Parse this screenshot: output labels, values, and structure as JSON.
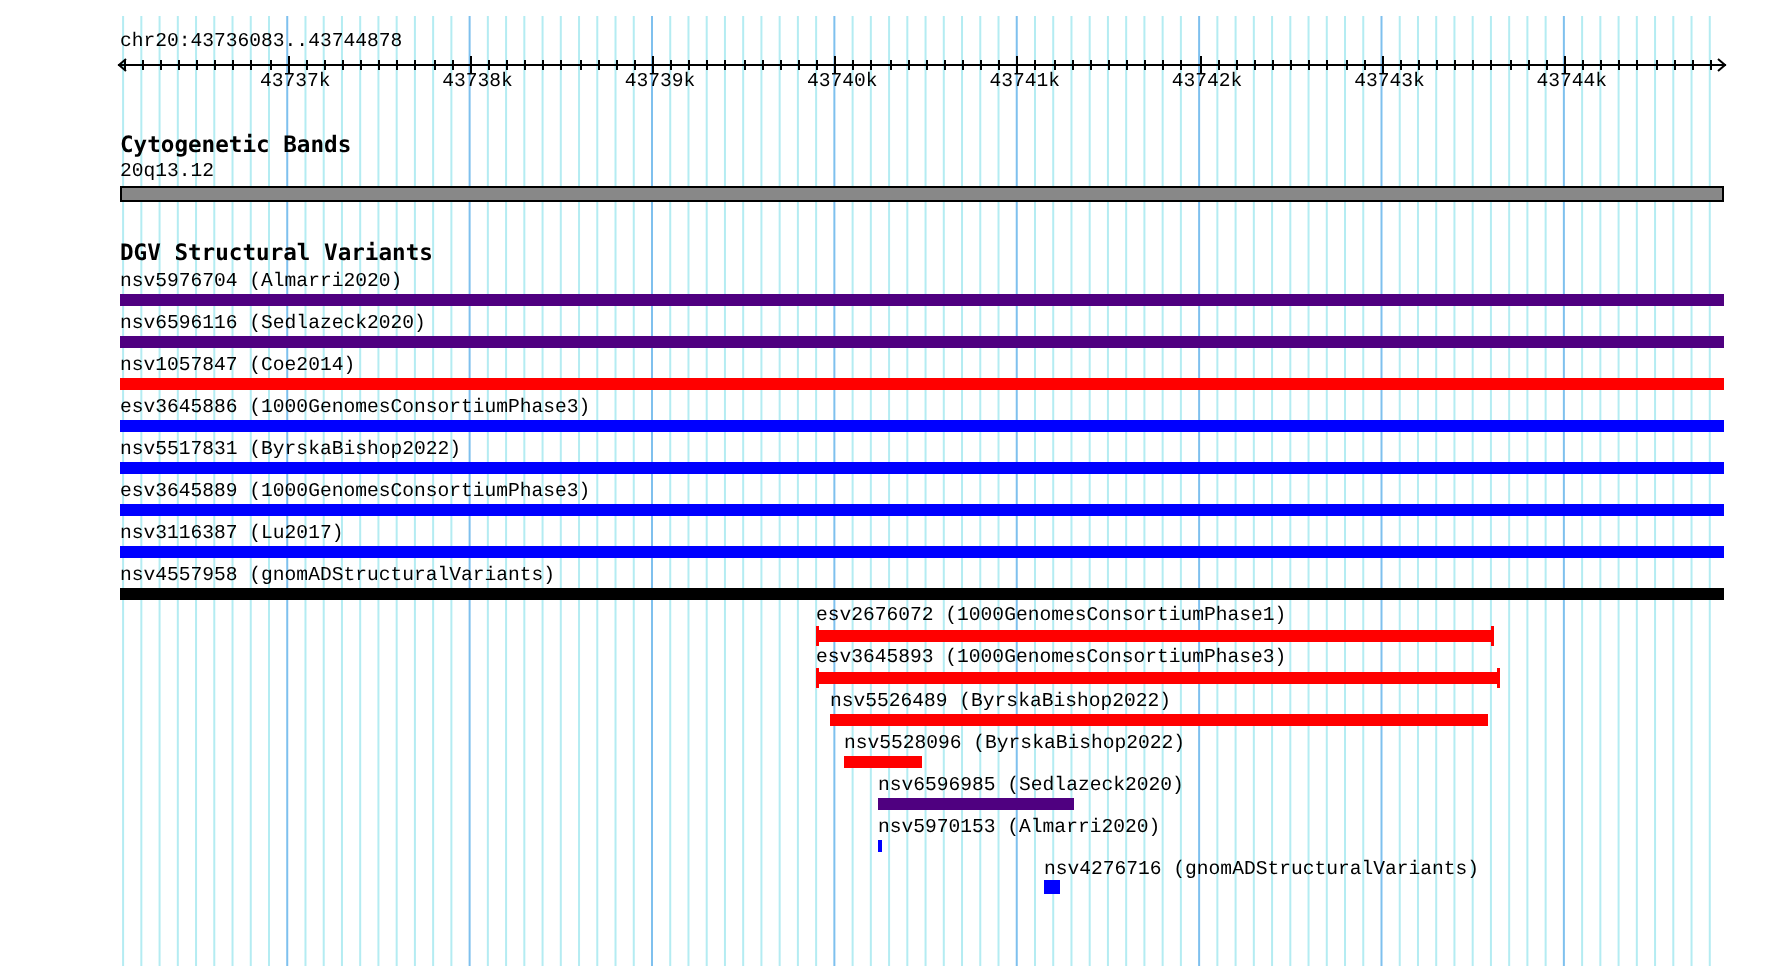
{
  "position": "chr20:43736083..43744878",
  "ruler": {
    "ticks": [
      "43737k",
      "43738k",
      "43739k",
      "43740k",
      "43741k",
      "43742k",
      "43743k",
      "43744k"
    ]
  },
  "tracks": [
    {
      "title": "Cytogenetic Bands",
      "features": [
        {
          "label": "20q13.12",
          "color": "#888888",
          "kind": "band"
        }
      ]
    },
    {
      "title": "DGV Structural Variants",
      "features": [
        {
          "label": "nsv5976704 (Almarri2020)",
          "color": "#4f0080",
          "kind": "span"
        },
        {
          "label": "nsv6596116 (Sedlazeck2020)",
          "color": "#4f0080",
          "kind": "span"
        },
        {
          "label": "nsv1057847 (Coe2014)",
          "color": "#ff0000",
          "kind": "span"
        },
        {
          "label": "esv3645886 (1000GenomesConsortiumPhase3)",
          "color": "#0000ff",
          "kind": "span"
        },
        {
          "label": "nsv5517831 (ByrskaBishop2022)",
          "color": "#0000ff",
          "kind": "span"
        },
        {
          "label": "esv3645889 (1000GenomesConsortiumPhase3)",
          "color": "#0000ff",
          "kind": "span"
        },
        {
          "label": "nsv3116387 (Lu2017)",
          "color": "#0000ff",
          "kind": "span"
        },
        {
          "label": "nsv4557958 (gnomADStructuralVariants)",
          "color": "#000000",
          "kind": "span"
        },
        {
          "label": "esv2676072 (1000GenomesConsortiumPhase1)",
          "color": "#ff0000",
          "kind": "capped"
        },
        {
          "label": "esv3645893 (1000GenomesConsortiumPhase3)",
          "color": "#ff0000",
          "kind": "capped"
        },
        {
          "label": "nsv5526489 (ByrskaBishop2022)",
          "color": "#ff0000",
          "kind": "span"
        },
        {
          "label": "nsv5528096 (ByrskaBishop2022)",
          "color": "#ff0000",
          "kind": "span"
        },
        {
          "label": "nsv6596985 (Sedlazeck2020)",
          "color": "#4f0080",
          "kind": "span"
        },
        {
          "label": "nsv5970153 (Almarri2020)",
          "color": "#0000ff",
          "kind": "span"
        },
        {
          "label": "nsv4276716 (gnomADStructuralVariants)",
          "color": "#0000ff",
          "kind": "span"
        }
      ]
    }
  ]
}
